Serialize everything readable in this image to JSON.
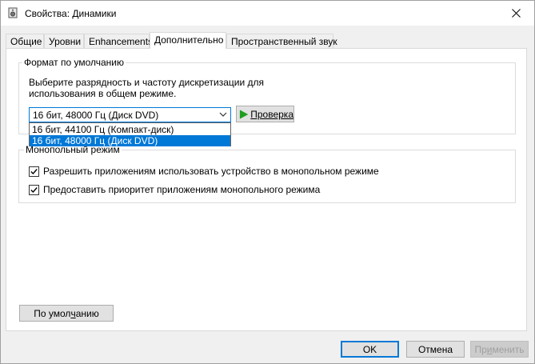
{
  "window": {
    "title": "Свойства: Динамики"
  },
  "tabs": [
    {
      "label": "Общие"
    },
    {
      "label": "Уровни"
    },
    {
      "label": "Enhancements"
    },
    {
      "label": "Дополнительно",
      "active": true
    },
    {
      "label": "Пространственный звук"
    }
  ],
  "default_format": {
    "group_label": "Формат по умолчанию",
    "description": "Выберите разрядность и частоту дискретизации для использования в общем режиме.",
    "selected_value": "16 бит, 48000 Гц (Диск DVD)",
    "options": [
      {
        "label": "16 бит, 44100 Гц (Компакт-диск)",
        "selected": false
      },
      {
        "label": "16 бит, 48000 Гц (Диск DVD)",
        "selected": true
      }
    ],
    "test_button": "Проверка"
  },
  "exclusive_mode": {
    "group_label": "Монопольный режим",
    "options": [
      {
        "label": "Разрешить приложениям использовать устройство в монопольном режиме",
        "checked": true
      },
      {
        "label": "Предоставить приоритет приложениям монопольного режима",
        "checked": true
      }
    ]
  },
  "buttons": {
    "defaults_pre": "По умол",
    "defaults_accel": "ч",
    "defaults_post": "анию",
    "ok": "OK",
    "cancel": "Отмена",
    "apply_pre": "Пр",
    "apply_accel": "и",
    "apply_post": "менить"
  },
  "colors": {
    "accent": "#0078d7",
    "play_green": "#1e9e1e"
  }
}
